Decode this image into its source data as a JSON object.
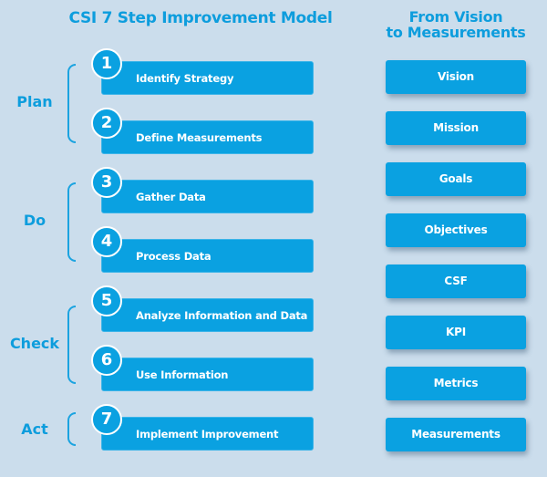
{
  "left_title": "CSI 7 Step Improvement Model",
  "right_title_line1": "From Vision",
  "right_title_line2": "to Measurements",
  "colors": {
    "background": "#cbddec",
    "accent": "#0aa1e1",
    "heading": "#0d9ddd",
    "text_on_accent": "#ffffff"
  },
  "phases": [
    {
      "label": "Plan",
      "steps": [
        1,
        2
      ]
    },
    {
      "label": "Do",
      "steps": [
        3,
        4
      ]
    },
    {
      "label": "Check",
      "steps": [
        5,
        6
      ]
    },
    {
      "label": "Act",
      "steps": [
        7
      ]
    }
  ],
  "steps": [
    {
      "number": "1",
      "label": "Identify Strategy"
    },
    {
      "number": "2",
      "label": "Define Measurements"
    },
    {
      "number": "3",
      "label": "Gather Data"
    },
    {
      "number": "4",
      "label": "Process Data"
    },
    {
      "number": "5",
      "label": "Analyze Information and Data"
    },
    {
      "number": "6",
      "label": "Use Information"
    },
    {
      "number": "7",
      "label": "Implement Improvement"
    }
  ],
  "vision_to_measurements": [
    "Vision",
    "Mission",
    "Goals",
    "Objectives",
    "CSF",
    "KPI",
    "Metrics",
    "Measurements"
  ]
}
